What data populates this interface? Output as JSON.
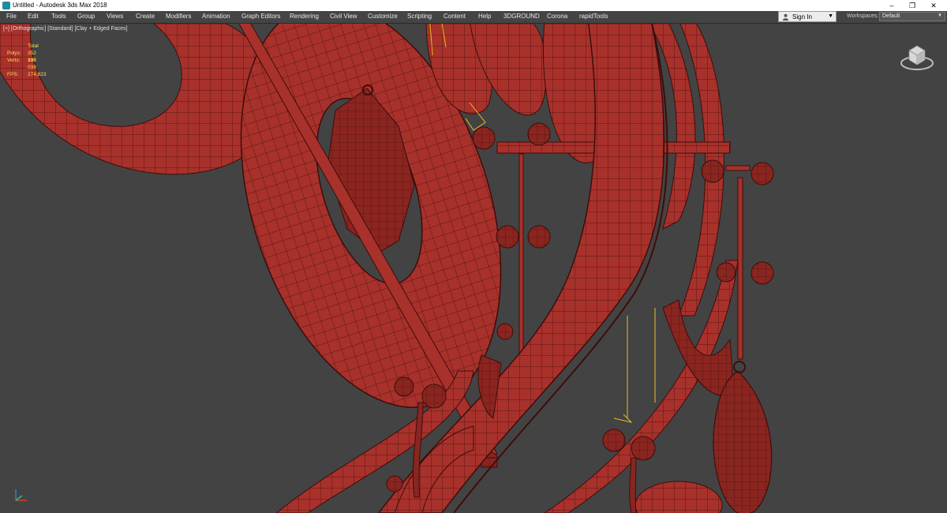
{
  "window": {
    "title": "Untitled - Autodesk 3ds Max 2018",
    "minimize": "–",
    "restore": "❐",
    "close": "✕"
  },
  "menu": [
    "File",
    "Edit",
    "Tools",
    "Group",
    "Views",
    "Create",
    "Modifiers",
    "Animation",
    "Graph Editors",
    "Rendering",
    "Civil View",
    "Customize",
    "Scripting",
    "Content",
    "Help",
    "3DGROUND",
    "Corona",
    "rapidTools"
  ],
  "account": {
    "signin_label": "Sign In",
    "workspaces_label": "Workspaces:",
    "workspace_value": "Default"
  },
  "viewport": {
    "label": "[+] [Orthographic] [Standard] [Clay + Edged Faces]",
    "stats": {
      "header": "Total",
      "polys_label": "Polys:",
      "polys_value": "352 335",
      "verts_label": "Verts:",
      "verts_value": "196 038",
      "fps_label": "FPS:",
      "fps_value": "274,823"
    }
  },
  "colors": {
    "clay": "#a8312b",
    "clay_dark": "#6e1d19",
    "wire": "#3d0d0b",
    "selection": "#e6c020",
    "viewport_bg": "#434343"
  },
  "icons": [
    "app-icon",
    "user-icon",
    "viewcube-icon",
    "axis-gizmo-icon"
  ]
}
